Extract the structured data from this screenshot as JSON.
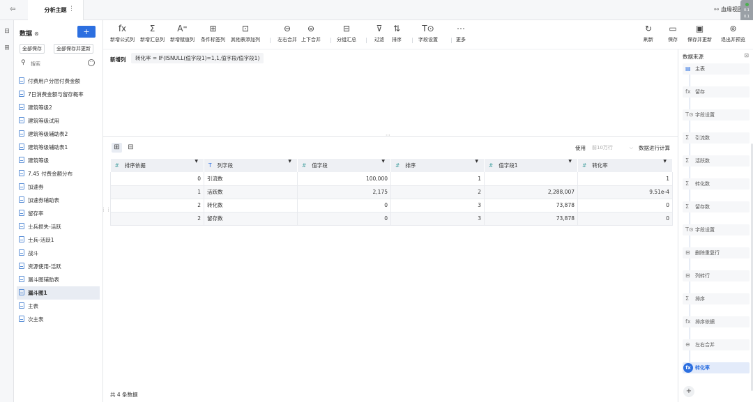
{
  "topbar": {
    "tab_label": "分析主题",
    "lineage_label": "血缘视图"
  },
  "float_widget": {
    "line1": "0.1",
    "line2": "0.1"
  },
  "left_panel": {
    "title": "数据",
    "add_label": "+",
    "save_all": "全部保存",
    "save_all_update": "全部保存并更新",
    "search_placeholder": "搜索",
    "items": [
      "付费用户分层付费金额",
      "7日消费金额与留存概率",
      "建筑等级2",
      "建筑等级试用",
      "建筑等级辅助表2",
      "建筑等级辅助表1",
      "建筑等级",
      "7.45 付费金额分布",
      "加速券",
      "加速券辅助表",
      "留存率",
      "士兵损失-活跃",
      "士兵-活跃1",
      "战斗",
      "资源使用-活跃",
      "漏斗图辅助表",
      "漏斗图1",
      "主表",
      "次主表"
    ],
    "active_item": "漏斗图1"
  },
  "toolbar": {
    "left": [
      {
        "icon": "fx",
        "label": "新增公式列"
      },
      {
        "icon": "Σ",
        "label": "新增汇总列"
      },
      {
        "icon": "A⁼",
        "label": "新增赋值列"
      },
      {
        "icon": "⊞",
        "label": "条件标签列"
      },
      {
        "icon": "⊡",
        "label": "其他表添加列"
      },
      {
        "icon": "⊖",
        "label": "左右合并"
      },
      {
        "icon": "⊜",
        "label": "上下合并"
      },
      {
        "icon": "⊟",
        "label": "分组汇总"
      },
      {
        "icon": "⊽",
        "label": "过滤"
      },
      {
        "icon": "⇅",
        "label": "排序"
      },
      {
        "icon": "T⊙",
        "label": "字段设置"
      },
      {
        "icon": "⋯",
        "label": "更多"
      }
    ],
    "right": [
      {
        "icon": "↻",
        "label": "刷新"
      },
      {
        "icon": "▭",
        "label": "保存"
      },
      {
        "icon": "▣",
        "label": "保存并更新"
      },
      {
        "icon": "⊚",
        "label": "退出并预览"
      }
    ]
  },
  "formula": {
    "label": "新增列",
    "text": "转化率 = IF(ISNULL(值字段1)=1,1,值字段/值字段1)"
  },
  "tablebar": {
    "use_label": "使用",
    "rows_option": "前10万行",
    "calc_label": "数据进行计算"
  },
  "table": {
    "columns": [
      {
        "type": "#",
        "name": "排序依据"
      },
      {
        "type": "T",
        "name": "列字段"
      },
      {
        "type": "#",
        "name": "值字段"
      },
      {
        "type": "#",
        "name": "排序"
      },
      {
        "type": "#",
        "name": "值字段1"
      },
      {
        "type": "#",
        "name": "转化率"
      }
    ],
    "rows": [
      [
        "0",
        "引流数",
        "100,000",
        "1",
        "",
        "1"
      ],
      [
        "1",
        "活跃数",
        "2,175",
        "2",
        "2,288,007",
        "9.51e-4"
      ],
      [
        "2",
        "转化数",
        "0",
        "3",
        "73,878",
        "0"
      ],
      [
        "2",
        "留存数",
        "0",
        "3",
        "73,878",
        "0"
      ]
    ]
  },
  "footer": {
    "count_text": "共 4 条数据"
  },
  "right_panel": {
    "title": "数据来源",
    "steps": [
      {
        "icon": "▤",
        "label": "主表",
        "kind": "main"
      },
      {
        "icon": "fx",
        "label": "留存",
        "kind": "normal"
      },
      {
        "icon": "T⊙",
        "label": "字段设置",
        "kind": "normal"
      },
      {
        "icon": "Σ",
        "label": "引流数",
        "kind": "normal"
      },
      {
        "icon": "Σ",
        "label": "活跃数",
        "kind": "normal"
      },
      {
        "icon": "Σ",
        "label": "转化数",
        "kind": "normal"
      },
      {
        "icon": "Σ",
        "label": "留存数",
        "kind": "normal"
      },
      {
        "icon": "T⊙",
        "label": "字段设置",
        "kind": "normal"
      },
      {
        "icon": "⊟",
        "label": "删除重复行",
        "kind": "normal"
      },
      {
        "icon": "⊟",
        "label": "列转行",
        "kind": "normal"
      },
      {
        "icon": "Σ",
        "label": "排序",
        "kind": "normal"
      },
      {
        "icon": "fx",
        "label": "排序依据",
        "kind": "normal"
      },
      {
        "icon": "⊖",
        "label": "左右合并",
        "kind": "normal"
      },
      {
        "icon": "fx",
        "label": "转化率",
        "kind": "active"
      }
    ],
    "add_label": "+"
  }
}
